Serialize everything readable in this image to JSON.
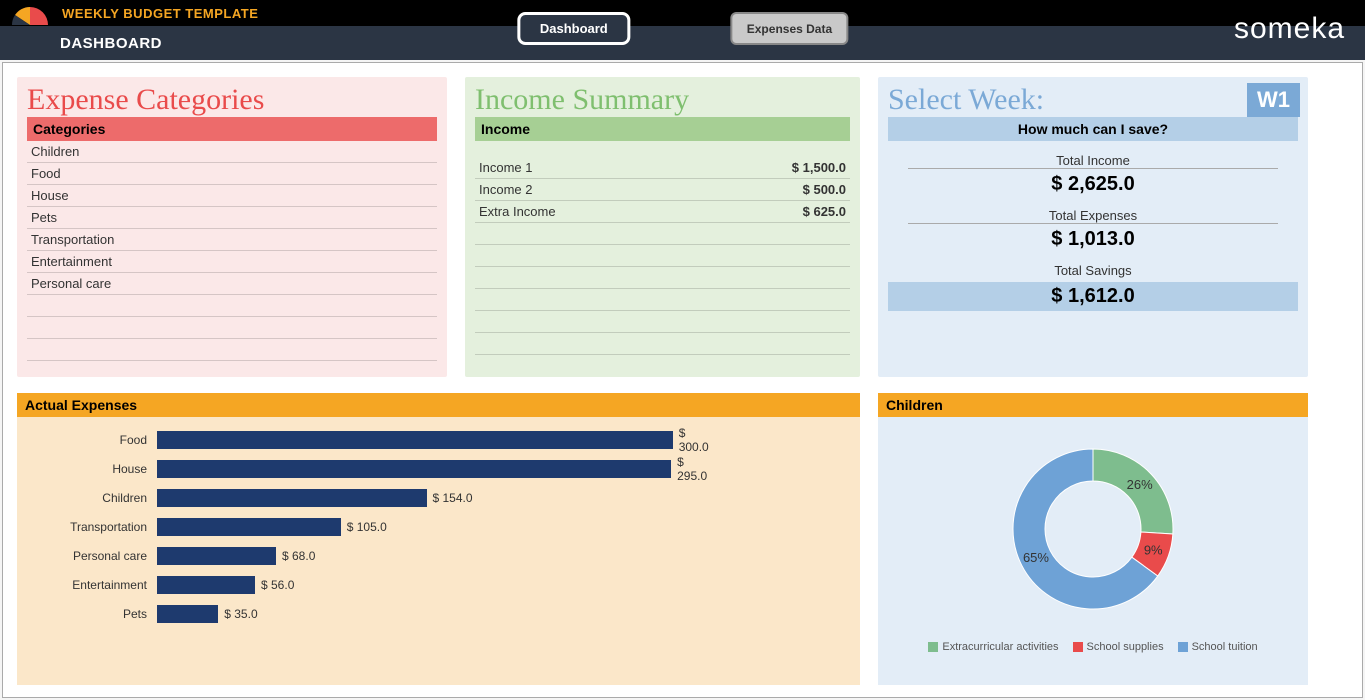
{
  "header": {
    "product_title": "WEEKLY BUDGET TEMPLATE",
    "page_label": "DASHBOARD",
    "nav_dashboard": "Dashboard",
    "nav_expenses": "Expenses Data",
    "brand": "someka"
  },
  "expense_panel": {
    "title": "Expense Categories",
    "header": "Categories",
    "items": [
      "Children",
      "Food",
      "House",
      "Pets",
      "Transportation",
      "Entertainment",
      "Personal care"
    ]
  },
  "income_panel": {
    "title": "Income Summary",
    "header": "Income",
    "rows": [
      {
        "label": "Income 1",
        "value": "$  1,500.0"
      },
      {
        "label": "Income 2",
        "value": "$  500.0"
      },
      {
        "label": "Extra Income",
        "value": "$  625.0"
      }
    ]
  },
  "week_panel": {
    "title": "Select Week:",
    "badge": "W1",
    "header": "How much can I save?",
    "summary": [
      {
        "label": "Total Income",
        "value": "$  2,625.0",
        "highlight": false
      },
      {
        "label": "Total Expenses",
        "value": "$  1,013.0",
        "highlight": false
      },
      {
        "label": "Total Savings",
        "value": "$  1,612.0",
        "highlight": true
      }
    ]
  },
  "actual_panel": {
    "header": "Actual Expenses"
  },
  "child_panel": {
    "header": "Children",
    "legend": [
      {
        "label": "Extracurricular activities",
        "color": "#7ebd8e"
      },
      {
        "label": "School supplies",
        "color": "#e94b4b"
      },
      {
        "label": "School tuition",
        "color": "#6ea2d6"
      }
    ]
  },
  "chart_data": [
    {
      "type": "bar",
      "title": "Actual Expenses",
      "orientation": "horizontal",
      "categories": [
        "Food",
        "House",
        "Children",
        "Transportation",
        "Personal care",
        "Entertainment",
        "Pets"
      ],
      "values": [
        300.0,
        295.0,
        154.0,
        105.0,
        68.0,
        56.0,
        35.0
      ],
      "value_labels": [
        "$ 300.0",
        "$ 295.0",
        "$ 154.0",
        "$ 105.0",
        "$ 68.0",
        "$ 56.0",
        "$ 35.0"
      ],
      "xlim": [
        0,
        320
      ]
    },
    {
      "type": "pie",
      "title": "Children",
      "subtype": "donut",
      "categories": [
        "Extracurricular activities",
        "School supplies",
        "School tuition"
      ],
      "values": [
        26,
        9,
        65
      ],
      "colors": [
        "#7ebd8e",
        "#e94b4b",
        "#6ea2d6"
      ]
    }
  ]
}
